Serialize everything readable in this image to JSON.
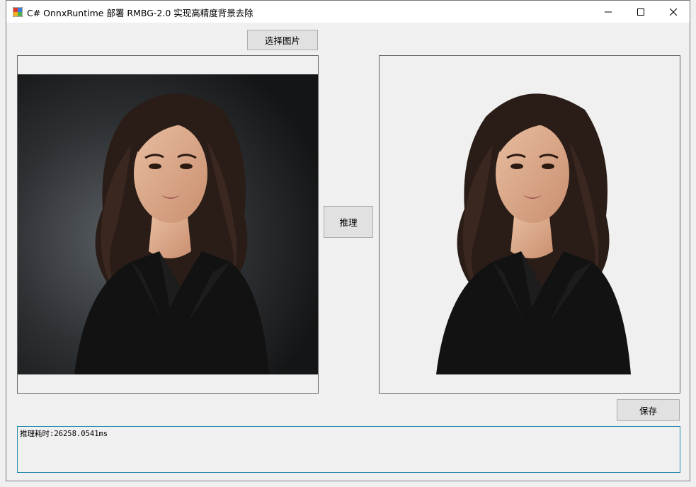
{
  "window": {
    "title": "C# OnnxRuntime 部署 RMBG-2.0 实现高精度背景去除",
    "controls": {
      "minimize": "minimize-icon",
      "maximize": "maximize-icon",
      "close": "close-icon"
    }
  },
  "toolbar": {
    "select_image_label": "选择图片",
    "infer_label": "推理",
    "save_label": "保存"
  },
  "images": {
    "source": "portrait of woman in black blazer on dark gradient background",
    "result": "same portrait with background removed"
  },
  "log": {
    "text": "推理耗时:26258.0541ms"
  }
}
